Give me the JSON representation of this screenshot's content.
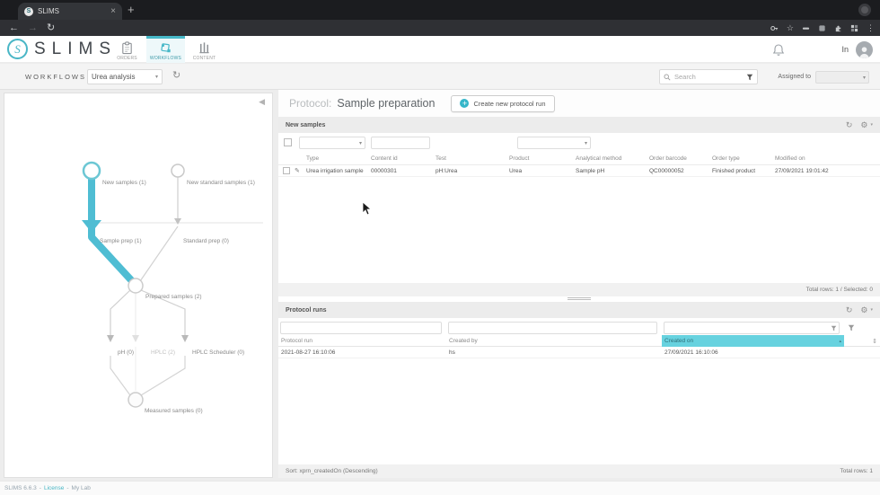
{
  "colors": {
    "accent": "#45b7c8",
    "highlight": "#68d2df"
  },
  "glyphs": {
    "close": "×",
    "plus": "+",
    "back": "←",
    "forward": "→",
    "reload": "↻",
    "star": "☆",
    "menu": "⋮",
    "caret": "▾",
    "refresh": "↻",
    "gear": "⚙",
    "edit": "✎",
    "collapse": "◀",
    "sort_up": "▴",
    "updown": "⇕"
  },
  "browser": {
    "tab_title": "SLIMS"
  },
  "app_header": {
    "logo_letter": "S",
    "logo_text": "SLIMS",
    "nav": [
      {
        "label": "ORDERS"
      },
      {
        "label": "WORKFLOWS"
      },
      {
        "label": "CONTENT"
      }
    ],
    "user_label": "In"
  },
  "workflow_bar": {
    "section_label": "WORKFLOWS",
    "workflow_selected": "Urea analysis",
    "search_placeholder": "Search",
    "assigned_to_label": "Assigned to"
  },
  "diagram": {
    "nodes": {
      "new_samples": "New samples (1)",
      "new_standard_samples": "New standard samples (1)",
      "sample_prep": "Sample prep (1)",
      "standard_prep": "Standard prep (0)",
      "prepared_samples": "Prepared samples (2)",
      "ph": "pH (0)",
      "hplc": "HPLC (2)",
      "hplc_scheduler": "HPLC Scheduler (0)",
      "measured_samples": "Measured samples (0)"
    }
  },
  "protocol": {
    "label": "Protocol:",
    "name": "Sample preparation",
    "create_button": "Create new protocol run"
  },
  "new_samples": {
    "title": "New samples",
    "columns": [
      "Type",
      "Content id",
      "Test",
      "Product",
      "Analytical method",
      "Order barcode",
      "Order type",
      "Modified on"
    ],
    "rows": [
      {
        "type": "Urea irrigation sample",
        "content_id": "00000301",
        "test": "pH:Urea",
        "product": "Urea",
        "analytical_method": "Sample pH",
        "order_barcode": "QC00000052",
        "order_type": "Finished product",
        "modified_on": "27/09/2021 19:01:42"
      }
    ],
    "footer": "Total rows: 1 / Selected: 0"
  },
  "protocol_runs": {
    "title": "Protocol runs",
    "columns": [
      "Protocol run",
      "Created by",
      "Created on"
    ],
    "rows": [
      {
        "protocol_run": "2021-08-27 16:10:06",
        "created_by": "hs",
        "created_on": "27/09/2021 16:10:06"
      }
    ],
    "sort_text": "Sort: xprn_createdOn (Descending)",
    "footer": "Total rows: 1"
  },
  "status_bar": {
    "version": "SLIMS 6.6.3",
    "dash": "-",
    "license": "License",
    "dash2": "-",
    "lab": "My Lab"
  }
}
